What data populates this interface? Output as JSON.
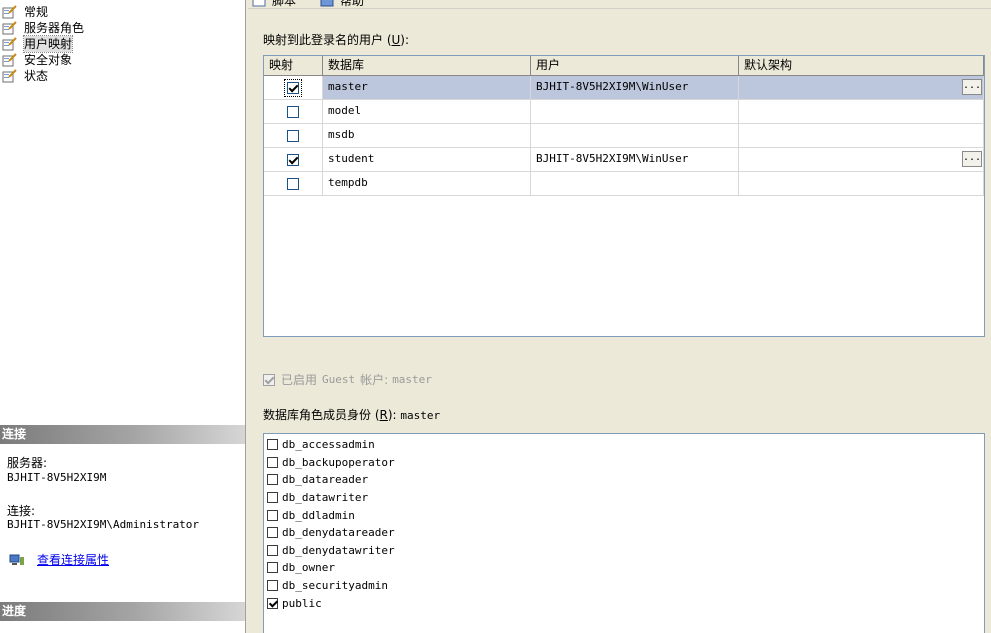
{
  "nav": {
    "items": [
      {
        "label": "常规"
      },
      {
        "label": "服务器角色"
      },
      {
        "label": "用户映射"
      },
      {
        "label": "安全对象"
      },
      {
        "label": "状态"
      }
    ],
    "selected_index": 2
  },
  "connection": {
    "header": "连接",
    "server_label": "服务器:",
    "server_value": "BJHIT-8V5H2XI9M",
    "connection_label": "连接:",
    "connection_value": "BJHIT-8V5H2XI9M\\Administrator",
    "view_properties_link": "查看连接属性"
  },
  "progress": {
    "header": "进度"
  },
  "toolbar": {
    "script_label": "脚本",
    "help_label": "帮助"
  },
  "mapping": {
    "label_prefix": "映射到此登录名的用户 (",
    "label_key": "U",
    "label_suffix": "):",
    "columns": [
      "映射",
      "数据库",
      "用户",
      "默认架构"
    ],
    "rows": [
      {
        "mapped": true,
        "database": "master",
        "user": "BJHIT-8V5H2XI9M\\WinUser",
        "schema": "",
        "has_browse": true,
        "selected": true
      },
      {
        "mapped": false,
        "database": "model",
        "user": "",
        "schema": "",
        "has_browse": false,
        "selected": false
      },
      {
        "mapped": false,
        "database": "msdb",
        "user": "",
        "schema": "",
        "has_browse": false,
        "selected": false
      },
      {
        "mapped": true,
        "database": "student",
        "user": "BJHIT-8V5H2XI9M\\WinUser",
        "schema": "",
        "has_browse": true,
        "selected": false
      },
      {
        "mapped": false,
        "database": "tempdb",
        "user": "",
        "schema": "",
        "has_browse": false,
        "selected": false
      }
    ],
    "browse_label": "..."
  },
  "guest": {
    "checked": true,
    "enabled": false,
    "label_cjk": "已启用",
    "label_mid": "Guest",
    "label_cjk2": "帐户:",
    "database": "master"
  },
  "roles": {
    "label_prefix": "数据库角色成员身份 (",
    "label_key": "R",
    "label_suffix": "):",
    "database": "master",
    "items": [
      {
        "name": "db_accessadmin",
        "checked": false
      },
      {
        "name": "db_backupoperator",
        "checked": false
      },
      {
        "name": "db_datareader",
        "checked": false
      },
      {
        "name": "db_datawriter",
        "checked": false
      },
      {
        "name": "db_ddladmin",
        "checked": false
      },
      {
        "name": "db_denydatareader",
        "checked": false
      },
      {
        "name": "db_denydatawriter",
        "checked": false
      },
      {
        "name": "db_owner",
        "checked": false
      },
      {
        "name": "db_securityadmin",
        "checked": false
      },
      {
        "name": "public",
        "checked": true
      }
    ]
  }
}
